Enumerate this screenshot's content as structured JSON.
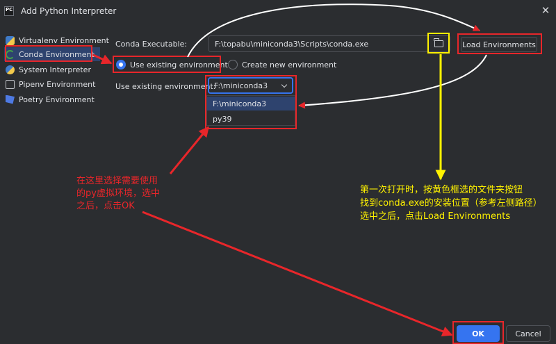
{
  "window": {
    "title": "Add Python Interpreter",
    "close": "✕",
    "app_icon_text": "PC"
  },
  "sidebar": {
    "items": [
      {
        "label": "Virtualenv Environment",
        "icon": "virtualenv-icon"
      },
      {
        "label": "Conda Environment",
        "icon": "conda-icon",
        "selected": true
      },
      {
        "label": "System Interpreter",
        "icon": "python-icon"
      },
      {
        "label": "Pipenv Environment",
        "icon": "pipenv-icon"
      },
      {
        "label": "Poetry Environment",
        "icon": "poetry-icon"
      }
    ]
  },
  "form": {
    "conda_exe_label": "Conda Executable:",
    "conda_exe_value": "F:\\topabu\\miniconda3\\Scripts\\conda.exe",
    "load_button": "Load Environments",
    "radio_existing": "Use existing environment",
    "radio_new": "Create new environment",
    "existing_env_label": "Use existing environment:",
    "existing_env_value": "F:\\miniconda3",
    "dropdown_options": [
      "F:\\miniconda3",
      "py39"
    ]
  },
  "annotations": {
    "left_lines": [
      "在这里选择需要使用",
      "的py虚拟环境，选中",
      "之后，点击OK"
    ],
    "right_lines": [
      "第一次打开时，按黄色框选的文件夹按钮",
      "找到conda.exe的安装位置（参考左侧路径）",
      "选中之后，点击Load Environments"
    ]
  },
  "footer": {
    "ok": "OK",
    "cancel": "Cancel"
  },
  "colors": {
    "accent": "#3574f0",
    "annotation_red": "#e8262a",
    "annotation_yellow": "#fff200",
    "background": "#2b2d30"
  }
}
